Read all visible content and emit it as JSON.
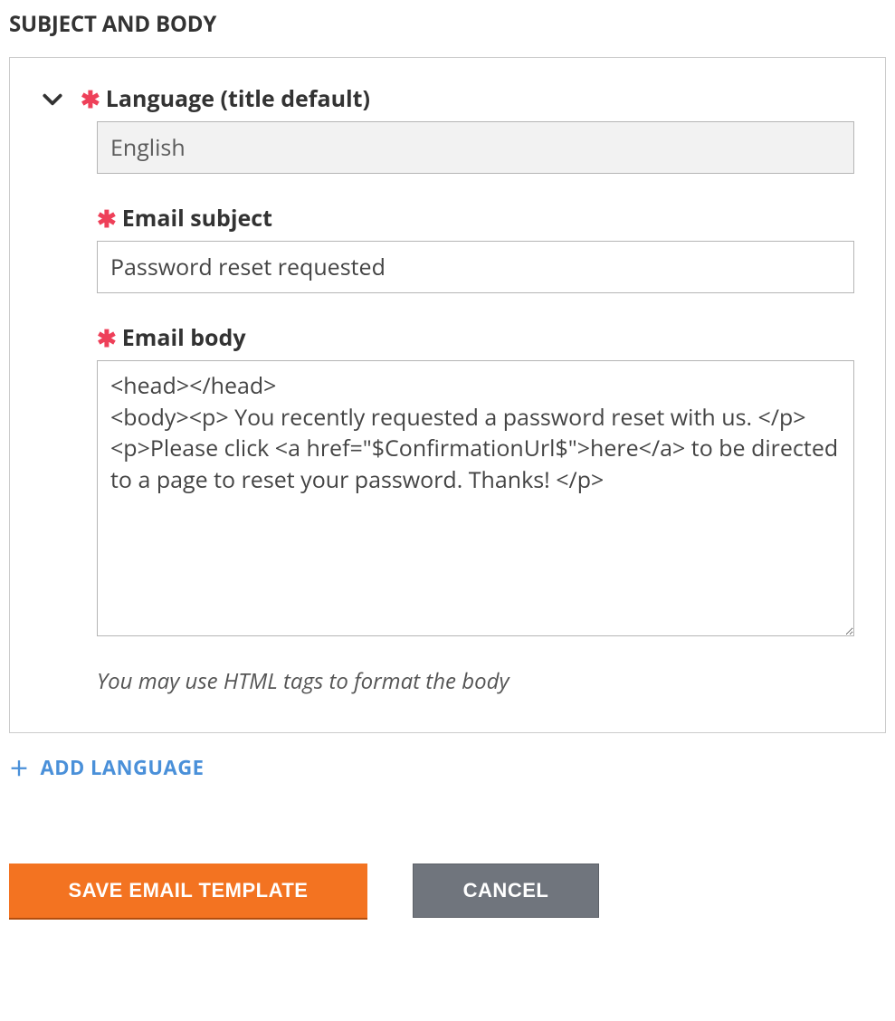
{
  "section_title": "SUBJECT AND BODY",
  "language": {
    "label": "Language (title default)",
    "value": "English"
  },
  "subject": {
    "label": "Email subject",
    "value": "Password reset requested"
  },
  "body": {
    "label": "Email body",
    "value": "<head></head>\n<body><p> You recently requested a password reset with us. </p>\n<p>Please click <a href=\"$ConfirmationUrl$\">here</a> to be directed to a page to reset your password. Thanks! </p>",
    "hint": "You may use HTML tags to format the body"
  },
  "add_language_label": "ADD LANGUAGE",
  "buttons": {
    "save": "SAVE EMAIL TEMPLATE",
    "cancel": "CANCEL"
  }
}
